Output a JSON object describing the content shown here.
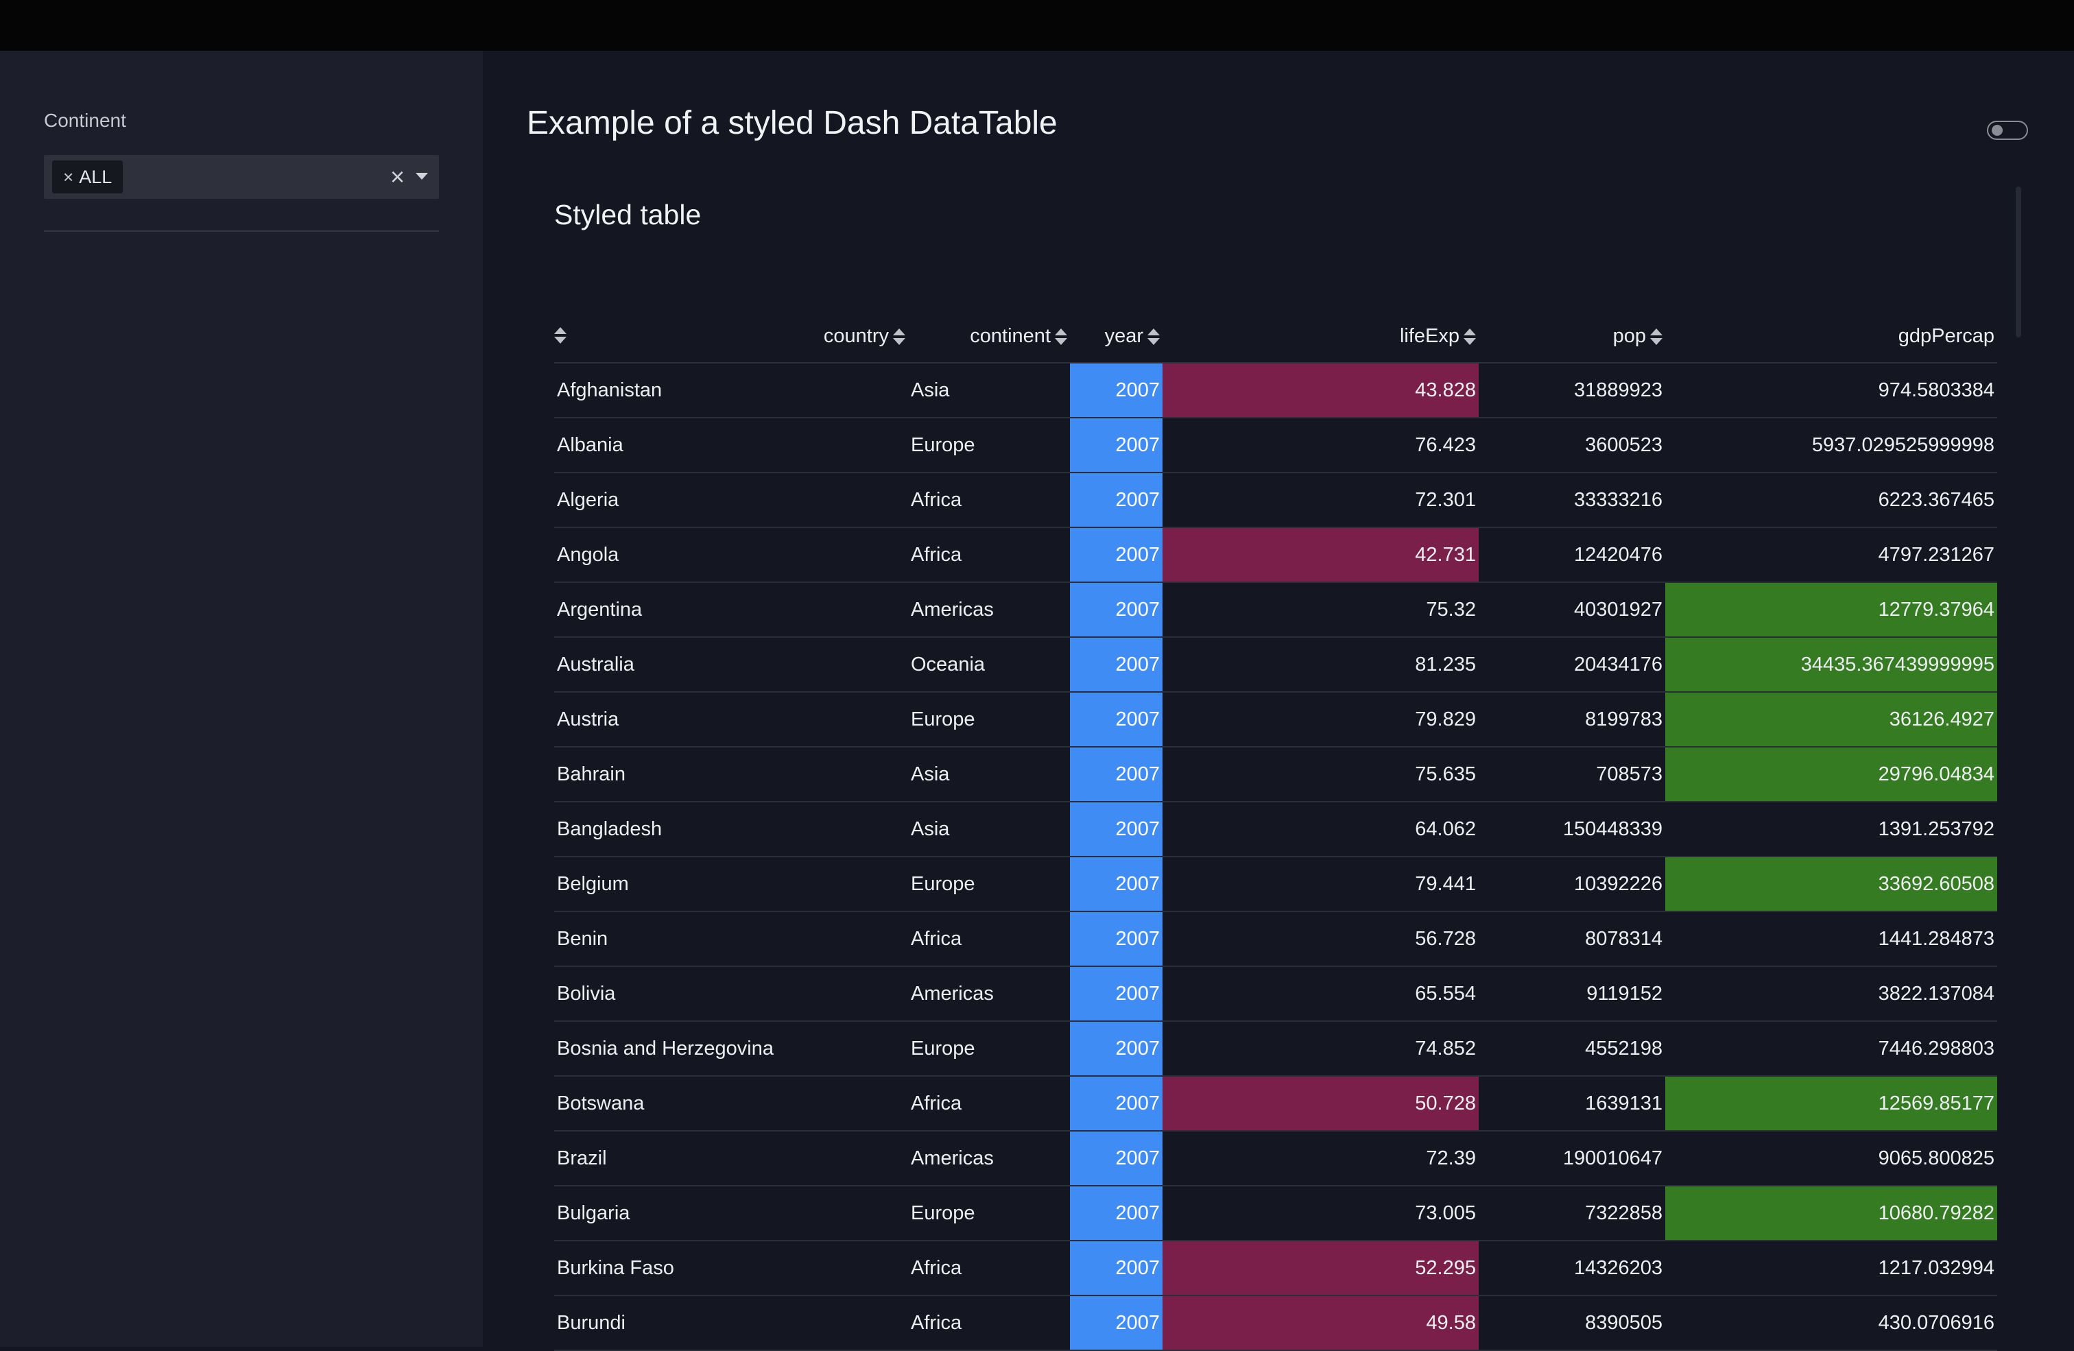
{
  "sidebar": {
    "filter_label": "Continent",
    "selected_chip": "ALL",
    "chip_remove_glyph": "×",
    "clear_glyph": "×"
  },
  "main": {
    "page_title": "Example of a styled Dash DataTable",
    "card_title": "Styled table"
  },
  "table": {
    "columns": [
      {
        "label": ""
      },
      {
        "label": "country"
      },
      {
        "label": "continent"
      },
      {
        "label": "year"
      },
      {
        "label": "lifeExp"
      },
      {
        "label": "pop"
      },
      {
        "label": "gdpPercap"
      }
    ],
    "rows": [
      {
        "country": "Afghanistan",
        "continent": "Asia",
        "year": "2007",
        "lifeExp": "43.828",
        "pop": "31889923",
        "gdpPercap": "974.5803384",
        "life_low": true,
        "gdp_high": false
      },
      {
        "country": "Albania",
        "continent": "Europe",
        "year": "2007",
        "lifeExp": "76.423",
        "pop": "3600523",
        "gdpPercap": "5937.029525999998",
        "life_low": false,
        "gdp_high": false
      },
      {
        "country": "Algeria",
        "continent": "Africa",
        "year": "2007",
        "lifeExp": "72.301",
        "pop": "33333216",
        "gdpPercap": "6223.367465",
        "life_low": false,
        "gdp_high": false
      },
      {
        "country": "Angola",
        "continent": "Africa",
        "year": "2007",
        "lifeExp": "42.731",
        "pop": "12420476",
        "gdpPercap": "4797.231267",
        "life_low": true,
        "gdp_high": false
      },
      {
        "country": "Argentina",
        "continent": "Americas",
        "year": "2007",
        "lifeExp": "75.32",
        "pop": "40301927",
        "gdpPercap": "12779.37964",
        "life_low": false,
        "gdp_high": true
      },
      {
        "country": "Australia",
        "continent": "Oceania",
        "year": "2007",
        "lifeExp": "81.235",
        "pop": "20434176",
        "gdpPercap": "34435.367439999995",
        "life_low": false,
        "gdp_high": true
      },
      {
        "country": "Austria",
        "continent": "Europe",
        "year": "2007",
        "lifeExp": "79.829",
        "pop": "8199783",
        "gdpPercap": "36126.4927",
        "life_low": false,
        "gdp_high": true
      },
      {
        "country": "Bahrain",
        "continent": "Asia",
        "year": "2007",
        "lifeExp": "75.635",
        "pop": "708573",
        "gdpPercap": "29796.04834",
        "life_low": false,
        "gdp_high": true
      },
      {
        "country": "Bangladesh",
        "continent": "Asia",
        "year": "2007",
        "lifeExp": "64.062",
        "pop": "150448339",
        "gdpPercap": "1391.253792",
        "life_low": false,
        "gdp_high": false
      },
      {
        "country": "Belgium",
        "continent": "Europe",
        "year": "2007",
        "lifeExp": "79.441",
        "pop": "10392226",
        "gdpPercap": "33692.60508",
        "life_low": false,
        "gdp_high": true
      },
      {
        "country": "Benin",
        "continent": "Africa",
        "year": "2007",
        "lifeExp": "56.728",
        "pop": "8078314",
        "gdpPercap": "1441.284873",
        "life_low": false,
        "gdp_high": false
      },
      {
        "country": "Bolivia",
        "continent": "Americas",
        "year": "2007",
        "lifeExp": "65.554",
        "pop": "9119152",
        "gdpPercap": "3822.137084",
        "life_low": false,
        "gdp_high": false
      },
      {
        "country": "Bosnia and Herzegovina",
        "continent": "Europe",
        "year": "2007",
        "lifeExp": "74.852",
        "pop": "4552198",
        "gdpPercap": "7446.298803",
        "life_low": false,
        "gdp_high": false
      },
      {
        "country": "Botswana",
        "continent": "Africa",
        "year": "2007",
        "lifeExp": "50.728",
        "pop": "1639131",
        "gdpPercap": "12569.85177",
        "life_low": true,
        "gdp_high": true
      },
      {
        "country": "Brazil",
        "continent": "Americas",
        "year": "2007",
        "lifeExp": "72.39",
        "pop": "190010647",
        "gdpPercap": "9065.800825",
        "life_low": false,
        "gdp_high": false
      },
      {
        "country": "Bulgaria",
        "continent": "Europe",
        "year": "2007",
        "lifeExp": "73.005",
        "pop": "7322858",
        "gdpPercap": "10680.79282",
        "life_low": false,
        "gdp_high": true
      },
      {
        "country": "Burkina Faso",
        "continent": "Africa",
        "year": "2007",
        "lifeExp": "52.295",
        "pop": "14326203",
        "gdpPercap": "1217.032994",
        "life_low": true,
        "gdp_high": false
      },
      {
        "country": "Burundi",
        "continent": "Africa",
        "year": "2007",
        "lifeExp": "49.58",
        "pop": "8390505",
        "gdpPercap": "430.0706916",
        "life_low": true,
        "gdp_high": false
      }
    ]
  },
  "colors": {
    "year_highlight": "#3f8cf5",
    "low_life_expectancy": "#7a1f4a",
    "high_gdp": "#357b22"
  },
  "icons": {
    "sort": "sort-arrows-icon",
    "clear": "clear-icon",
    "caret": "chevron-down-icon",
    "toggle": "toggle-switch"
  }
}
